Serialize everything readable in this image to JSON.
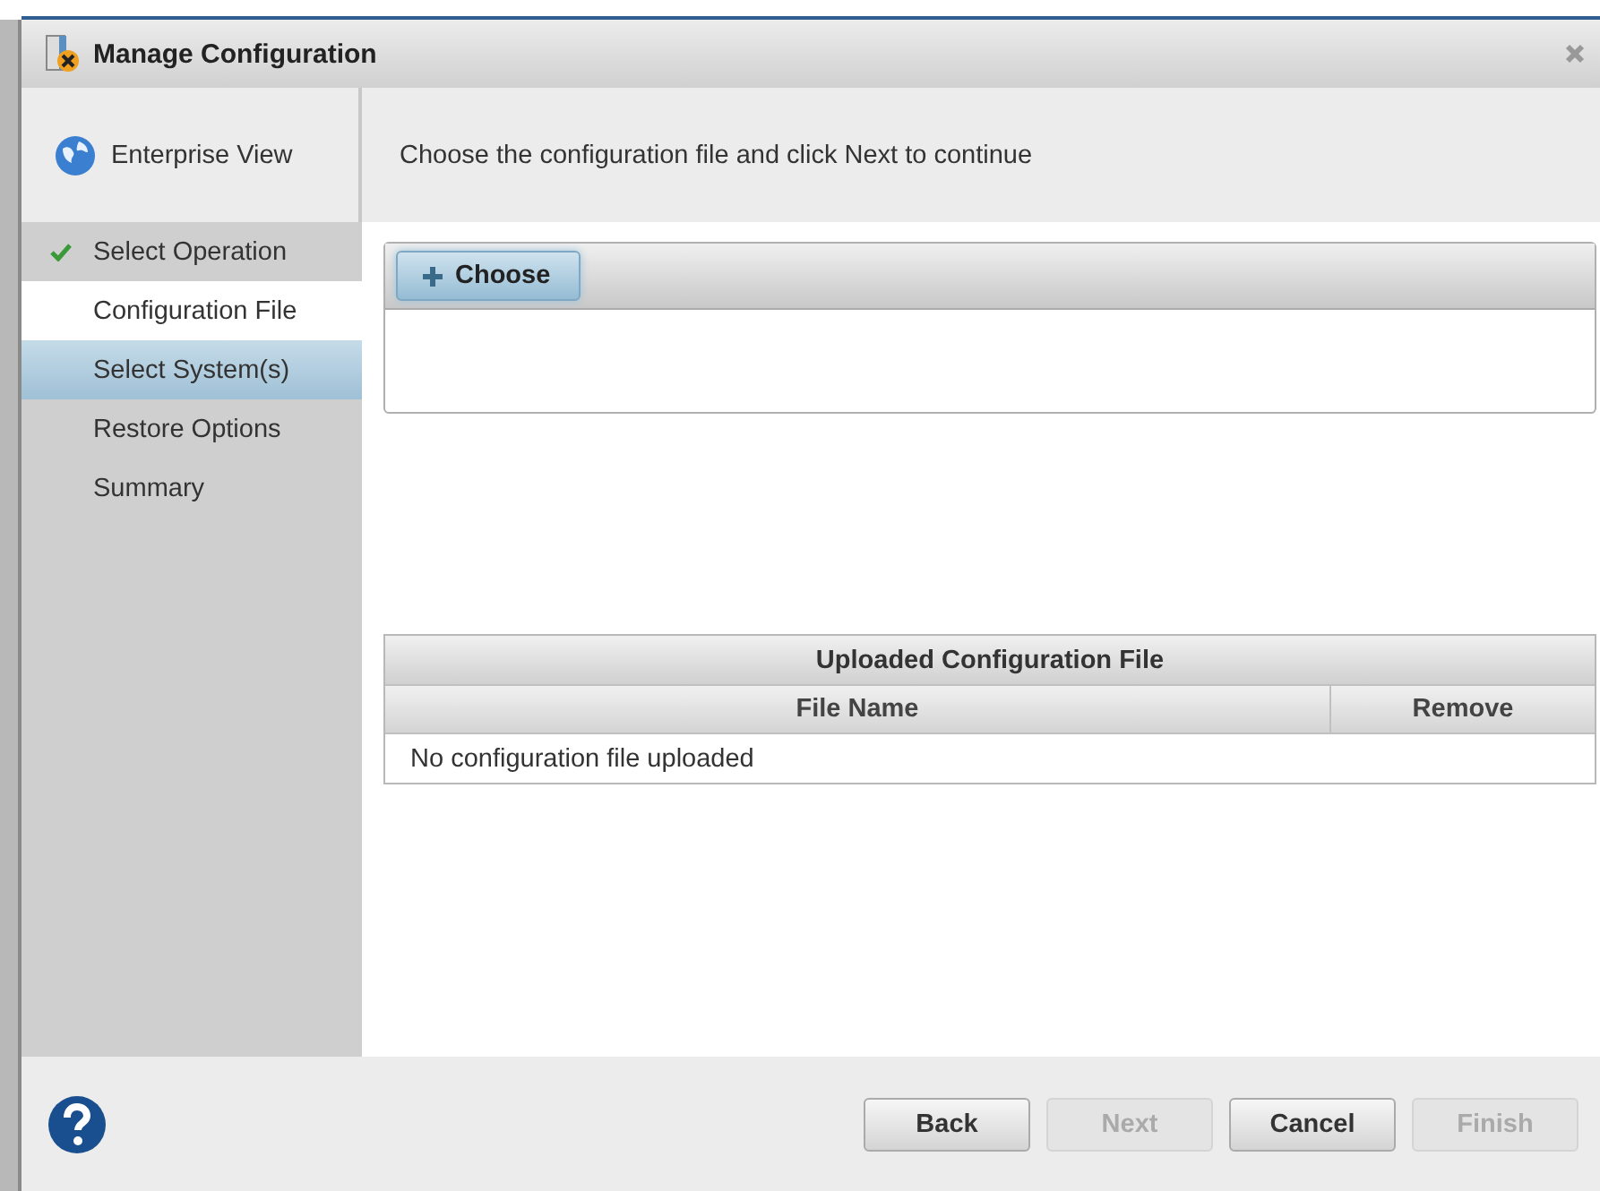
{
  "window": {
    "title": "Manage Configuration"
  },
  "sidebar": {
    "header": "Enterprise View",
    "steps": [
      {
        "label": "Select Operation",
        "done": true,
        "current": false,
        "selected": false
      },
      {
        "label": "Configuration File",
        "done": false,
        "current": true,
        "selected": false
      },
      {
        "label": "Select System(s)",
        "done": false,
        "current": false,
        "selected": true
      },
      {
        "label": "Restore Options",
        "done": false,
        "current": false,
        "selected": false
      },
      {
        "label": "Summary",
        "done": false,
        "current": false,
        "selected": false
      }
    ]
  },
  "instruction": "Choose the configuration file and click Next to continue",
  "choose_button": "Choose",
  "uploaded_table": {
    "title": "Uploaded Configuration File",
    "columns": [
      "File Name",
      "Remove"
    ],
    "empty_message": "No configuration file uploaded"
  },
  "buttons": [
    {
      "label": "Back",
      "disabled": false
    },
    {
      "label": "Next",
      "disabled": true
    },
    {
      "label": "Cancel",
      "disabled": false
    },
    {
      "label": "Finish",
      "disabled": true
    }
  ]
}
